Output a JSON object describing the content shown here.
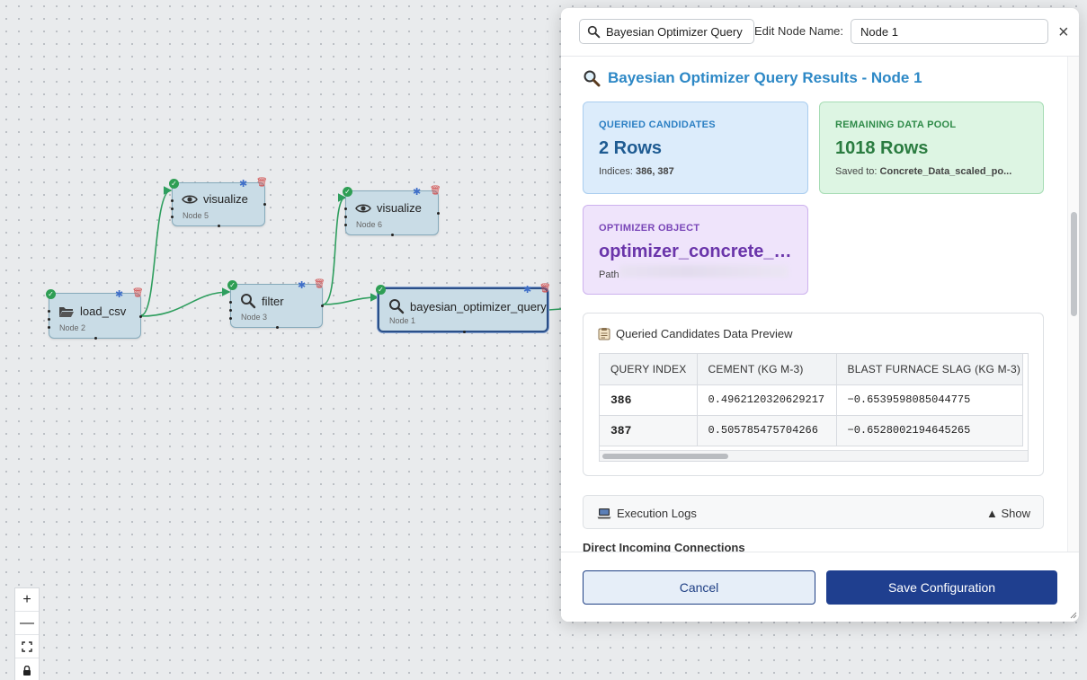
{
  "canvas": {
    "nodes": [
      {
        "name": "node-visualize-5",
        "label": "visualize",
        "sub": "Node 5",
        "icon": "eye-icon"
      },
      {
        "name": "node-visualize-6",
        "label": "visualize",
        "sub": "Node 6",
        "icon": "eye-icon"
      },
      {
        "name": "node-load-csv",
        "label": "load_csv",
        "sub": "Node 2",
        "icon": "folder-icon"
      },
      {
        "name": "node-filter",
        "label": "filter",
        "sub": "Node 3",
        "icon": "search-icon"
      },
      {
        "name": "node-bayesian",
        "label": "bayesian_optimizer_query",
        "sub": "Node 1",
        "icon": "search-icon"
      }
    ],
    "edge_color": "#2e9e5e",
    "zoom_controls": {
      "plus": "+",
      "minus": "—",
      "fit": "⛶",
      "lock": "🔒"
    }
  },
  "panel": {
    "search_pill": "Bayesian Optimizer Query",
    "edit_label": "Edit Node Name:",
    "node_name": "Node 1",
    "close": "×",
    "results_title": "Bayesian Optimizer Query Results - Node 1",
    "cards": {
      "queried": {
        "label": "QUERIED CANDIDATES",
        "value": "2 Rows",
        "sub_prefix": "Indices: ",
        "sub_value": "386, 387"
      },
      "remaining": {
        "label": "REMAINING DATA POOL",
        "value": "1018 Rows",
        "sub_prefix": "Saved to: ",
        "sub_value": "Concrete_Data_scaled_po..."
      },
      "optimizer": {
        "label": "OPTIMIZER OBJECT",
        "value": "optimizer_concrete_da...",
        "sub_prefix": "Path"
      }
    },
    "preview": {
      "title": "Queried Candidates Data Preview",
      "columns": [
        "QUERY INDEX",
        "CEMENT (KG M-3)",
        "BLAST FURNACE SLAG (KG M-3)"
      ],
      "rows": [
        [
          "386",
          "0.4962120320629217",
          "−0.6539598085044775"
        ],
        [
          "387",
          "0.505785475704266",
          "−0.6528002194645265"
        ]
      ]
    },
    "logs": {
      "title": "Execution Logs",
      "toggle": "▲ Show"
    },
    "direct_connections": "Direct Incoming Connections",
    "footer": {
      "cancel": "Cancel",
      "save": "Save Configuration"
    },
    "colors": {
      "title_blue": "#2d88c6",
      "primary": "#1f3f8f"
    }
  }
}
